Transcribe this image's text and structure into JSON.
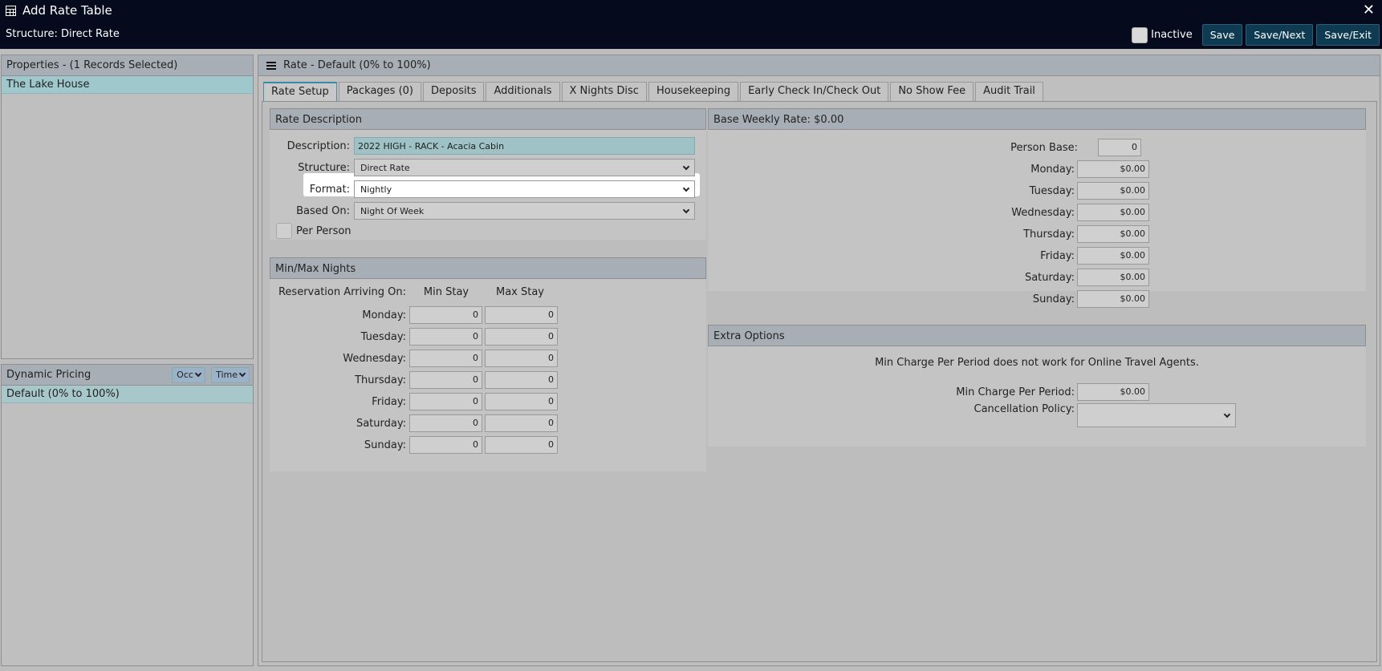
{
  "window": {
    "title": "Add Rate Table",
    "structure_text": "Structure: Direct Rate"
  },
  "actions": {
    "inactive_label": "Inactive",
    "save": "Save",
    "save_next": "Save/Next",
    "save_exit": "Save/Exit"
  },
  "properties": {
    "header": "Properties - (1 Records Selected)",
    "items": [
      "The Lake House"
    ]
  },
  "dynamic_pricing": {
    "header": "Dynamic Pricing",
    "occ_label": "Occ",
    "time_label": "Time",
    "items": [
      "Default (0% to 100%)"
    ]
  },
  "main": {
    "header": "Rate - Default (0% to 100%)",
    "tabs": [
      "Rate Setup",
      "Packages (0)",
      "Deposits",
      "Additionals",
      "X Nights Disc",
      "Housekeeping",
      "Early Check In/Check Out",
      "No Show Fee",
      "Audit Trail"
    ]
  },
  "rate_description": {
    "header": "Rate Description",
    "description_label": "Description:",
    "description_value": "2022 HIGH - RACK - Acacia Cabin",
    "structure_label": "Structure:",
    "structure_value": "Direct Rate",
    "format_label": "Format:",
    "format_value": "Nightly",
    "based_on_label": "Based On:",
    "based_on_value": "Night Of Week",
    "per_person_label": "Per Person"
  },
  "min_max": {
    "header": "Min/Max Nights",
    "arriving_label": "Reservation Arriving On:",
    "min_header": "Min Stay",
    "max_header": "Max Stay",
    "rows": [
      {
        "day": "Monday:",
        "min": "0",
        "max": "0"
      },
      {
        "day": "Tuesday:",
        "min": "0",
        "max": "0"
      },
      {
        "day": "Wednesday:",
        "min": "0",
        "max": "0"
      },
      {
        "day": "Thursday:",
        "min": "0",
        "max": "0"
      },
      {
        "day": "Friday:",
        "min": "0",
        "max": "0"
      },
      {
        "day": "Saturday:",
        "min": "0",
        "max": "0"
      },
      {
        "day": "Sunday:",
        "min": "0",
        "max": "0"
      }
    ]
  },
  "base_weekly": {
    "header": "Base Weekly Rate: $0.00",
    "person_base_label": "Person Base:",
    "person_base_value": "0",
    "rows": [
      {
        "day": "Monday:",
        "value": "$0.00"
      },
      {
        "day": "Tuesday:",
        "value": "$0.00"
      },
      {
        "day": "Wednesday:",
        "value": "$0.00"
      },
      {
        "day": "Thursday:",
        "value": "$0.00"
      },
      {
        "day": "Friday:",
        "value": "$0.00"
      },
      {
        "day": "Saturday:",
        "value": "$0.00"
      },
      {
        "day": "Sunday:",
        "value": "$0.00"
      }
    ]
  },
  "extra_options": {
    "header": "Extra Options",
    "note": "Min Charge Per Period does not work for Online Travel Agents.",
    "min_charge_label": "Min Charge Per Period:",
    "min_charge_value": "$0.00",
    "cancellation_label": "Cancellation Policy:",
    "cancellation_value": ""
  }
}
